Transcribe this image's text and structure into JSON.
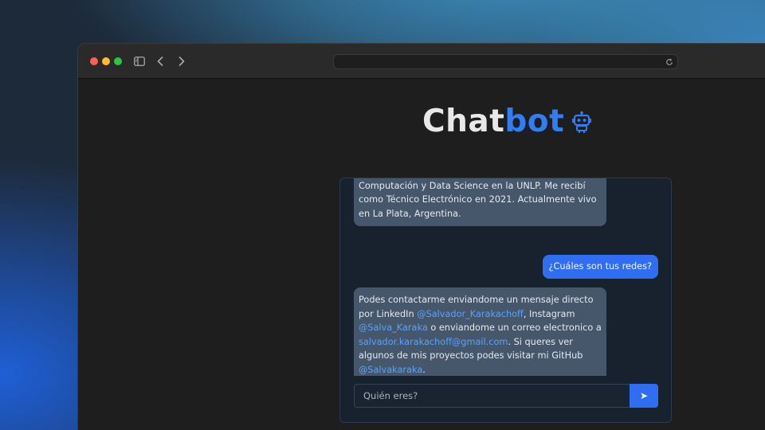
{
  "app": {
    "title_main": "Chat",
    "title_accent": "bot",
    "icon": "robot-icon"
  },
  "browser": {
    "icons": [
      "sidebar-icon",
      "chevron-left-icon",
      "chevron-right-icon",
      "reload-icon"
    ]
  },
  "chat": {
    "messages": [
      {
        "role": "bot",
        "parts": [
          {
            "text": "estudiante avanzado en las carreras de Ingeniería en Computación y Data Science en la UNLP. Me recibí como Técnico Electrónico en 2021. Actualmente vivo en La Plata, Argentina."
          }
        ]
      },
      {
        "role": "user",
        "parts": [
          {
            "text": "¿Cuáles son tus redes?"
          }
        ]
      },
      {
        "role": "bot",
        "parts": [
          {
            "text": "Podes contactarme enviandome un mensaje directo por LinkedIn "
          },
          {
            "text": "@Salvador_Karakachoff",
            "link": true
          },
          {
            "text": ", Instagram "
          },
          {
            "text": "@Salva_Karaka",
            "link": true
          },
          {
            "text": " o enviandome un correo electronico a "
          },
          {
            "text": "salvador.karakachoff@gmail.com",
            "link": true
          },
          {
            "text": ". Si queres ver algunos de mis proyectos podes visitar mi GitHub "
          },
          {
            "text": "@Salvakaraka",
            "link": true
          },
          {
            "text": "."
          }
        ]
      }
    ],
    "input_placeholder": "Quién eres?",
    "send_label": "➤"
  },
  "colors": {
    "accent": "#2f7ef6",
    "bot_bubble": "#46576c",
    "user_bubble": "#2f6ef2",
    "link": "#5aa0ff"
  }
}
